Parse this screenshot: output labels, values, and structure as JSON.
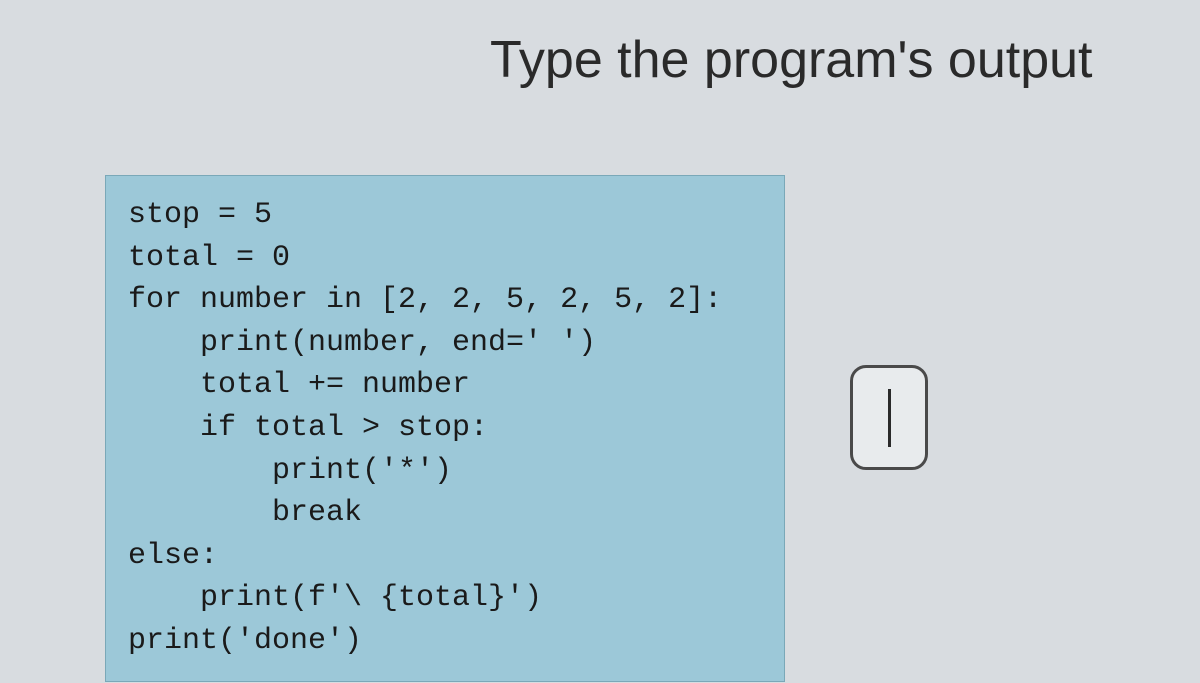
{
  "title": "Type the program's output",
  "code": {
    "line1": "stop = 5",
    "line2": "total = 0",
    "line3": "for number in [2, 2, 5, 2, 5, 2]:",
    "line4": "    print(number, end=' ')",
    "line5": "    total += number",
    "line6": "    if total > stop:",
    "line7": "        print('*')",
    "line8": "        break",
    "line9": "else:",
    "line10": "    print(f'\\ {total}')",
    "line11": "print('done')"
  },
  "input": {
    "value": ""
  }
}
